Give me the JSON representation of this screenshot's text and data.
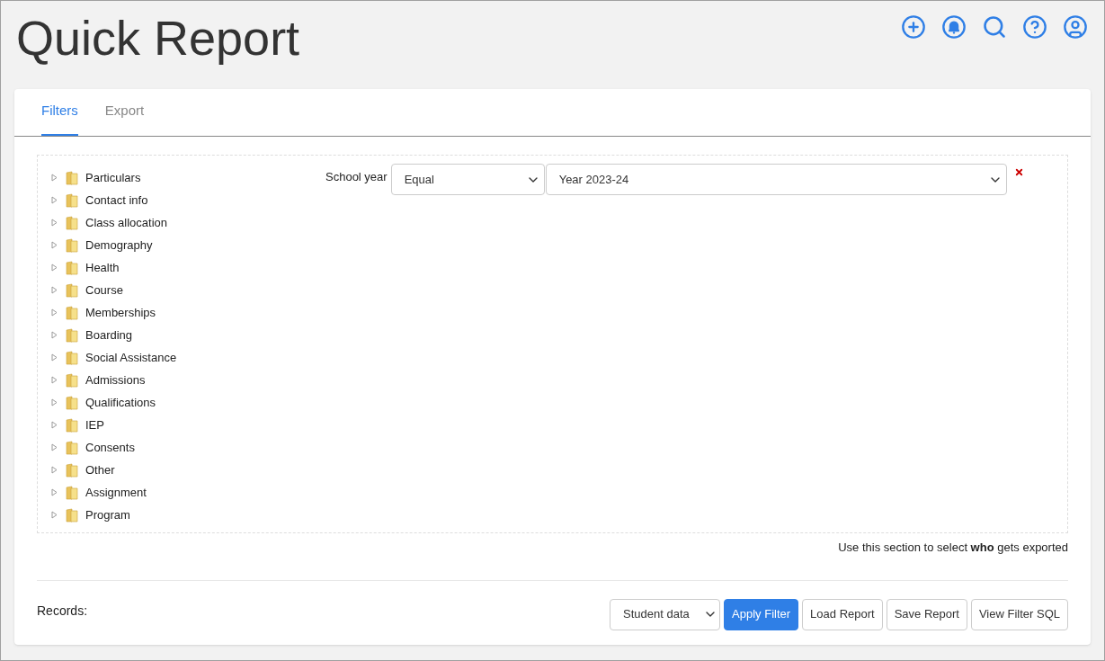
{
  "title": "Quick Report",
  "tabs": [
    {
      "label": "Filters",
      "selected": true
    },
    {
      "label": "Export",
      "selected": false
    }
  ],
  "tree": [
    {
      "label": "Particulars",
      "expanded": false
    },
    {
      "label": "Contact info",
      "expanded": false
    },
    {
      "label": "Class allocation",
      "expanded": false
    },
    {
      "label": "Demography",
      "expanded": false
    },
    {
      "label": "Health",
      "expanded": false
    },
    {
      "label": "Course",
      "expanded": false
    },
    {
      "label": "Memberships",
      "expanded": false
    },
    {
      "label": "Boarding",
      "expanded": false
    },
    {
      "label": "Social Assistance",
      "expanded": false
    },
    {
      "label": "Admissions",
      "expanded": false
    },
    {
      "label": "Qualifications",
      "expanded": false
    },
    {
      "label": "IEP",
      "expanded": false
    },
    {
      "label": "Consents",
      "expanded": false
    },
    {
      "label": "Other",
      "expanded": false
    },
    {
      "label": "Assignment",
      "expanded": false
    },
    {
      "label": "Program",
      "expanded": false
    }
  ],
  "filter": {
    "label": "School year",
    "operator": "Equal",
    "value": "Year 2023-24"
  },
  "hint": "Use this section to select **who** gets exported",
  "records": {
    "label": "Records:",
    "select": "Student data"
  },
  "buttons": [
    {
      "label": "Apply Filter",
      "kind": "primary"
    },
    {
      "label": "Load Report",
      "kind": "default"
    },
    {
      "label": "Save Report",
      "kind": "default"
    },
    {
      "label": "View Filter SQL",
      "kind": "default"
    }
  ]
}
